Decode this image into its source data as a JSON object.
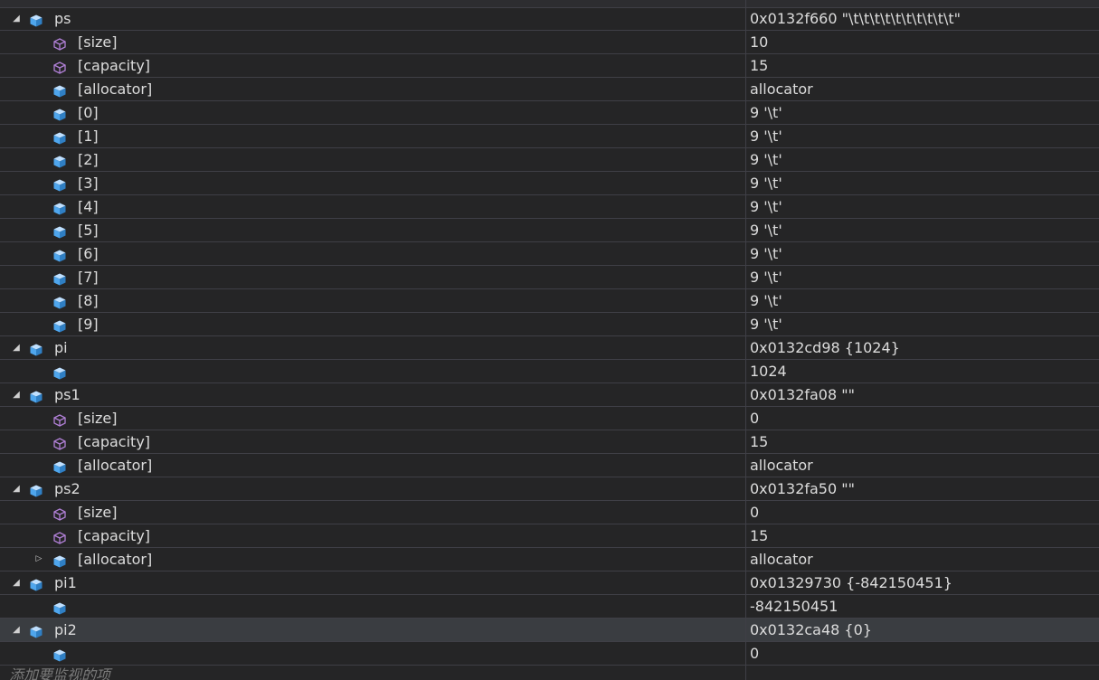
{
  "colors": {
    "background": "#252526",
    "grid_line": "#3f3f46",
    "selected_row": "#3a3d41",
    "object_icon": "#4fa6ed",
    "property_icon": "#b180d7",
    "text": "#dcdcdc"
  },
  "watch": {
    "rows": [
      {
        "name": "ps",
        "value": "0x0132f660 \"\\t\\t\\t\\t\\t\\t\\t\\t\\t\\t\"",
        "level": 0,
        "expander": "expanded",
        "icon": "object-icon"
      },
      {
        "name": "[size]",
        "value": "10",
        "level": 1,
        "expander": "none",
        "icon": "property-icon"
      },
      {
        "name": "[capacity]",
        "value": "15",
        "level": 1,
        "expander": "none",
        "icon": "property-icon"
      },
      {
        "name": "[allocator]",
        "value": "allocator",
        "level": 1,
        "expander": "none",
        "icon": "object-icon"
      },
      {
        "name": "[0]",
        "value": "9 '\\t'",
        "level": 1,
        "expander": "none",
        "icon": "object-icon"
      },
      {
        "name": "[1]",
        "value": "9 '\\t'",
        "level": 1,
        "expander": "none",
        "icon": "object-icon"
      },
      {
        "name": "[2]",
        "value": "9 '\\t'",
        "level": 1,
        "expander": "none",
        "icon": "object-icon"
      },
      {
        "name": "[3]",
        "value": "9 '\\t'",
        "level": 1,
        "expander": "none",
        "icon": "object-icon"
      },
      {
        "name": "[4]",
        "value": "9 '\\t'",
        "level": 1,
        "expander": "none",
        "icon": "object-icon"
      },
      {
        "name": "[5]",
        "value": "9 '\\t'",
        "level": 1,
        "expander": "none",
        "icon": "object-icon"
      },
      {
        "name": "[6]",
        "value": "9 '\\t'",
        "level": 1,
        "expander": "none",
        "icon": "object-icon"
      },
      {
        "name": "[7]",
        "value": "9 '\\t'",
        "level": 1,
        "expander": "none",
        "icon": "object-icon"
      },
      {
        "name": "[8]",
        "value": "9 '\\t'",
        "level": 1,
        "expander": "none",
        "icon": "object-icon"
      },
      {
        "name": "[9]",
        "value": "9 '\\t'",
        "level": 1,
        "expander": "none",
        "icon": "object-icon"
      },
      {
        "name": "pi",
        "value": "0x0132cd98 {1024}",
        "level": 0,
        "expander": "expanded",
        "icon": "object-icon"
      },
      {
        "name": "",
        "value": "1024",
        "level": 1,
        "expander": "none",
        "icon": "object-icon"
      },
      {
        "name": "ps1",
        "value": "0x0132fa08 \"\"",
        "level": 0,
        "expander": "expanded",
        "icon": "object-icon"
      },
      {
        "name": "[size]",
        "value": "0",
        "level": 1,
        "expander": "none",
        "icon": "property-icon"
      },
      {
        "name": "[capacity]",
        "value": "15",
        "level": 1,
        "expander": "none",
        "icon": "property-icon"
      },
      {
        "name": "[allocator]",
        "value": "allocator",
        "level": 1,
        "expander": "none",
        "icon": "object-icon"
      },
      {
        "name": "ps2",
        "value": "0x0132fa50 \"\"",
        "level": 0,
        "expander": "expanded",
        "icon": "object-icon"
      },
      {
        "name": "[size]",
        "value": "0",
        "level": 1,
        "expander": "none",
        "icon": "property-icon"
      },
      {
        "name": "[capacity]",
        "value": "15",
        "level": 1,
        "expander": "none",
        "icon": "property-icon"
      },
      {
        "name": "[allocator]",
        "value": "allocator",
        "level": 1,
        "expander": "collapsed",
        "icon": "object-icon"
      },
      {
        "name": "pi1",
        "value": "0x01329730 {-842150451}",
        "level": 0,
        "expander": "expanded",
        "icon": "object-icon"
      },
      {
        "name": "",
        "value": "-842150451",
        "level": 1,
        "expander": "none",
        "icon": "object-icon"
      },
      {
        "name": "pi2",
        "value": "0x0132ca48 {0}",
        "level": 0,
        "expander": "expanded",
        "icon": "object-icon",
        "selected": true
      },
      {
        "name": "",
        "value": "0",
        "level": 1,
        "expander": "none",
        "icon": "object-icon"
      }
    ],
    "add_watch_placeholder": "添加要监视的项"
  }
}
